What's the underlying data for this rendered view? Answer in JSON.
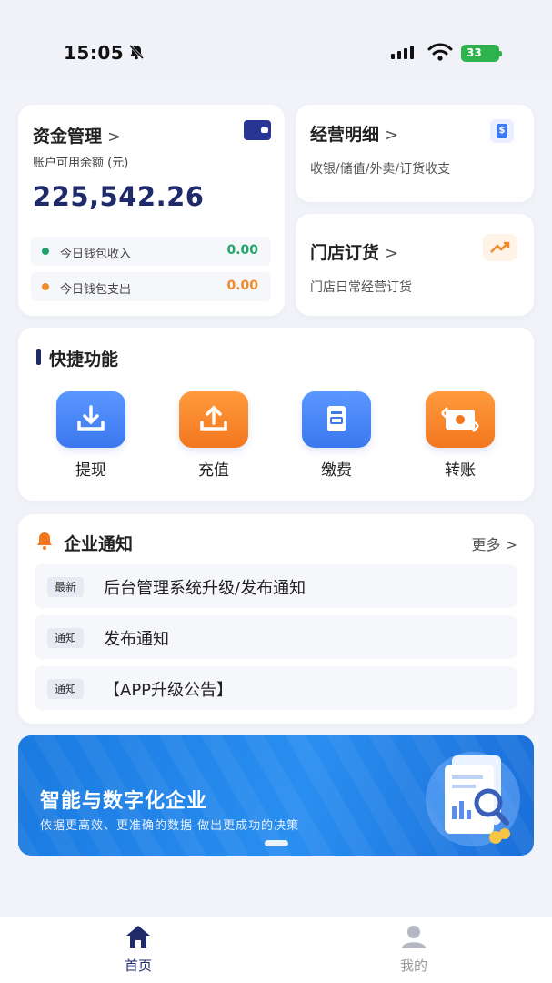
{
  "status": {
    "time": "15:05",
    "battery": "33"
  },
  "funds": {
    "title": "资金管理",
    "chevron": ">",
    "subtitle": "账户可用余额 (元)",
    "balance": "225,542.26",
    "income_label": "今日钱包收入",
    "income_value": "0.00",
    "expense_label": "今日钱包支出",
    "expense_value": "0.00",
    "colors": {
      "income": "#1ea66a",
      "expense": "#f28a2a"
    }
  },
  "operations": {
    "title": "经营明细",
    "chevron": ">",
    "subtitle": "收银/储值/外卖/订货收支",
    "icon": "dollar-document-icon"
  },
  "store_order": {
    "title": "门店订货",
    "chevron": ">",
    "subtitle": "门店日常经营订货",
    "icon": "trend-up-icon"
  },
  "quick": {
    "title": "快捷功能",
    "items": [
      {
        "label": "提现",
        "icon": "download-tray-icon"
      },
      {
        "label": "充值",
        "icon": "upload-tray-icon"
      },
      {
        "label": "缴费",
        "icon": "bill-icon"
      },
      {
        "label": "转账",
        "icon": "money-transfer-icon"
      }
    ]
  },
  "notice": {
    "title": "企业通知",
    "more": "更多",
    "more_chevron": ">",
    "items": [
      {
        "tag": "最新",
        "text": "后台管理系统升级/发布通知"
      },
      {
        "tag": "通知",
        "text": "发布通知"
      },
      {
        "tag": "通知",
        "text": "【APP升级公告】"
      }
    ]
  },
  "banner": {
    "headline": "智能与数字化企业",
    "tagline": "依据更高效、更准确的数据  做出更成功的决策"
  },
  "tabs": [
    {
      "label": "首页",
      "icon": "home-icon",
      "active": true
    },
    {
      "label": "我的",
      "icon": "user-icon",
      "active": false
    }
  ],
  "theme": {
    "primary": "#1f2a6b",
    "accent_blue": "#3b78ef",
    "accent_orange": "#f2771f"
  }
}
